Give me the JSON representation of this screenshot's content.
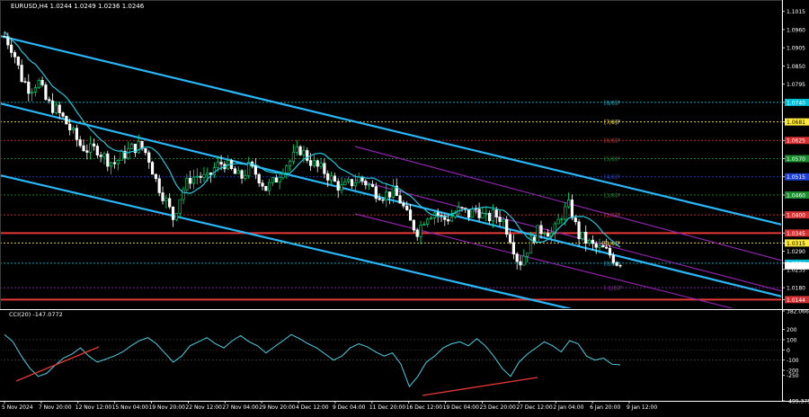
{
  "header": {
    "symbol_line": "EURUSD,H4  1.0244  1.0249  1.0236  1.0246",
    "cci_label": "CCI(20) -147.0772"
  },
  "chart_data": {
    "type": "candlestick",
    "symbol": "EURUSD",
    "timeframe": "H4",
    "ohlc_last": {
      "open": 1.0244,
      "high": 1.0249,
      "low": 1.0236,
      "close": 1.0246
    },
    "price_axis": {
      "ylim": [
        1.0115,
        1.1044
      ],
      "ticks": [
        "1.1015",
        "1.0960",
        "1.0905",
        "1.0850",
        "1.0795",
        "1.0740",
        "1.0681",
        "1.0625",
        "1.0570",
        "1.0515",
        "1.0460",
        "1.0400",
        "1.0345",
        "1.0315",
        "1.0290",
        "1.0254",
        "1.0235",
        "1.0180",
        "1.0144"
      ]
    },
    "time_axis": [
      "5 Nov 2024",
      "7 Nov 20:00",
      "12 Nov 12:00",
      "15 Nov 04:00",
      "19 Nov 20:00",
      "22 Nov 12:00",
      "27 Nov 04:00",
      "29 Nov 20:00",
      "4 Dec 12:00",
      "9 Dec 04:00",
      "11 Dec 20:00",
      "16 Dec 12:00",
      "19 Dec 04:00",
      "23 Dec 20:00",
      "27 Dec 12:00",
      "2 Jan 04:00",
      "6 Jan 20:00",
      "9 Jan 12:00"
    ],
    "price_path": [
      1.094,
      1.09,
      1.0815,
      1.078,
      1.0805,
      1.074,
      1.072,
      1.069,
      1.065,
      1.061,
      1.0595,
      1.06,
      1.057,
      1.0555,
      1.058,
      1.06,
      1.061,
      1.058,
      1.05,
      1.045,
      1.039,
      1.047,
      1.051,
      1.052,
      1.0505,
      1.0545,
      1.056,
      1.053,
      1.051,
      1.0545,
      1.052,
      1.048,
      1.05,
      1.0545,
      1.0565,
      1.06,
      1.057,
      1.0545,
      1.053,
      1.05,
      1.048,
      1.0495,
      1.051,
      1.0495,
      1.047,
      1.046,
      1.047,
      1.044,
      1.038,
      1.035,
      1.04,
      1.041,
      1.0385,
      1.0395,
      1.0415,
      1.04,
      1.042,
      1.0385,
      1.04,
      1.039,
      1.033,
      1.025,
      1.03,
      1.0345,
      1.036,
      1.034,
      1.04,
      1.043,
      1.034,
      1.032,
      1.03,
      1.0295,
      1.0275,
      1.0246
    ],
    "murrey_levels": [
      {
        "label": "[8/8]P",
        "price": 1.074,
        "color": "#00bcd4"
      },
      {
        "label": "[7/8]P",
        "price": 1.0681,
        "color": "#ffeb3b"
      },
      {
        "label": "[6/8]P",
        "price": 1.0625,
        "color": "#d32f2f"
      },
      {
        "label": "[5/8]P",
        "price": 1.057,
        "color": "#1b8a2e"
      },
      {
        "label": "[4/8]P",
        "price": 1.0515,
        "color": "#1e40d6"
      },
      {
        "label": "[3/8]P",
        "price": 1.046,
        "color": "#1b8a2e"
      },
      {
        "label": "[2/8]P",
        "price": 1.04,
        "color": "#d32f2f"
      },
      {
        "label": "[1/8]P",
        "price": 1.0315,
        "color": "#ffeb3b"
      },
      {
        "label": "[0/8]P",
        "price": 1.0254,
        "color": "#00bcd4"
      },
      {
        "label": "[-1/8]P",
        "price": 1.018,
        "color": "#8e24aa"
      }
    ],
    "cci": {
      "name": "CCI(20)",
      "last": -147.0772,
      "ylim": [
        -499.3751,
        382.0665
      ],
      "ticks": [
        "382.0665",
        "200",
        "100",
        "0",
        "-100",
        "-200",
        "-250",
        "-499.3751"
      ],
      "values": [
        150,
        80,
        -60,
        -180,
        -260,
        -230,
        -150,
        -80,
        -40,
        20,
        -60,
        -120,
        -90,
        -60,
        -20,
        40,
        90,
        120,
        60,
        -30,
        -120,
        -60,
        40,
        80,
        120,
        60,
        20,
        90,
        140,
        80,
        40,
        -30,
        30,
        90,
        150,
        110,
        60,
        20,
        -40,
        -100,
        -60,
        20,
        60,
        30,
        -20,
        -60,
        -30,
        -140,
        -360,
        -260,
        -120,
        -60,
        20,
        60,
        80,
        40,
        110,
        40,
        -60,
        -180,
        -260,
        -120,
        -40,
        20,
        80,
        40,
        -20,
        90,
        60,
        -60,
        -100,
        -80,
        -140,
        -147
      ]
    }
  }
}
